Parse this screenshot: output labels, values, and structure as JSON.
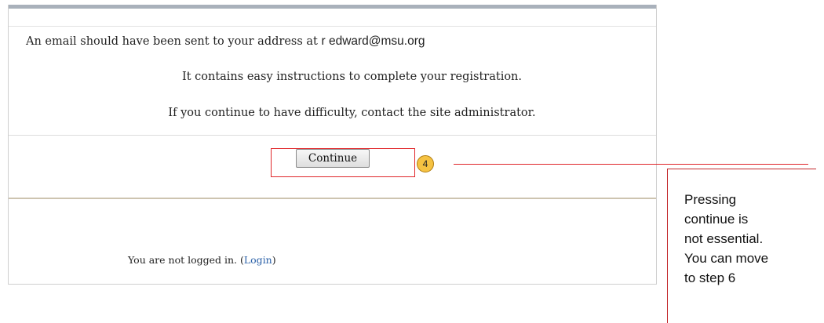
{
  "message": {
    "line1_prefix": "An email should have been sent to your address at ",
    "email": "r edward@msu.org",
    "line2": "It contains easy instructions to complete your registration.",
    "line3": "If you continue to have difficulty, contact the site administrator."
  },
  "actions": {
    "continue_label": "Continue"
  },
  "footer": {
    "text": "You are not logged in. (",
    "login_label": "Login",
    "suffix": ")"
  },
  "annotation": {
    "step_number": "4",
    "note_lines": [
      "Pressing",
      "continue is",
      "not essential.",
      "You can move",
      "to step 6"
    ],
    "color": "#e0262a",
    "badge_color": "#f5c242"
  }
}
